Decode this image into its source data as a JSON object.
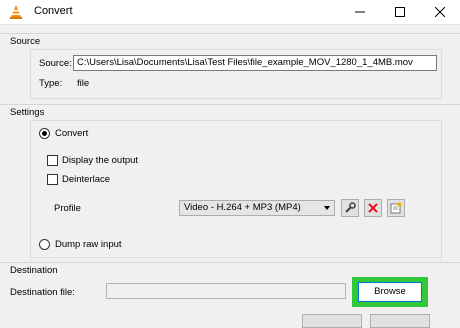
{
  "window": {
    "title": "Convert"
  },
  "source": {
    "section_label": "Source",
    "source_label": "Source:",
    "source_value": "C:\\Users\\Lisa\\Documents\\Lisa\\Test Files\\file_example_MOV_1280_1_4MB.mov",
    "type_label": "Type:",
    "type_value": "file"
  },
  "settings": {
    "section_label": "Settings",
    "convert_label": "Convert",
    "display_output_label": "Display the output",
    "deinterlace_label": "Deinterlace",
    "profile_label": "Profile",
    "profile_value": "Video - H.264 + MP3 (MP4)",
    "dump_raw_label": "Dump raw input"
  },
  "destination": {
    "section_label": "Destination",
    "file_label": "Destination file:",
    "file_value": "",
    "browse_label": "Browse"
  },
  "colors": {
    "highlight": "#32c83a",
    "delete_icon": "#e81123"
  }
}
